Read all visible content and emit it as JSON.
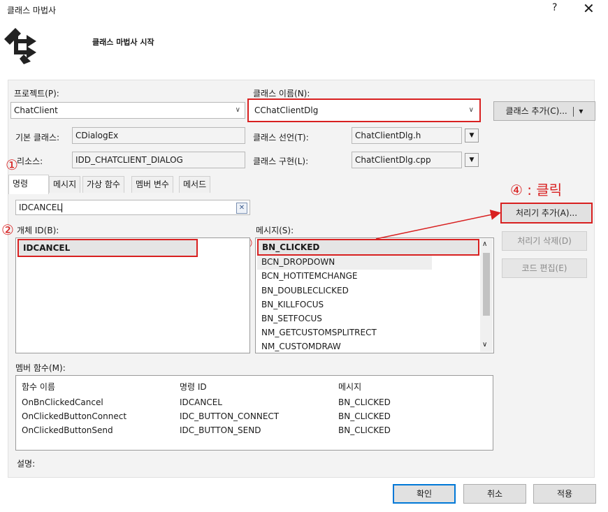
{
  "window": {
    "title": "클래스 마법사",
    "help_label": "?",
    "close_label": "✕"
  },
  "header": {
    "title": "클래스 마법사 시작",
    "logo_icon": "class-wizard-logo-icon"
  },
  "project": {
    "label": "프로젝트(P):",
    "value": "ChatClient"
  },
  "class_name": {
    "label": "클래스 이름(N):",
    "value": "CChatClientDlg"
  },
  "add_class": {
    "label": "클래스 추가(C)...",
    "arrow": "▾"
  },
  "base_class": {
    "label": "기본 클래스:",
    "value": "CDialogEx"
  },
  "resource": {
    "label": "리소스:",
    "value": "IDD_CHATCLIENT_DIALOG"
  },
  "class_decl": {
    "label": "클래스 선언(T):",
    "value": "ChatClientDlg.h"
  },
  "class_impl": {
    "label": "클래스 구현(L):",
    "value": "ChatClientDlg.cpp"
  },
  "tabs": [
    {
      "label": "명령"
    },
    {
      "label": "메시지"
    },
    {
      "label": "가상 함수"
    },
    {
      "label": "멤버 변수"
    },
    {
      "label": "메서드"
    }
  ],
  "search": {
    "value": "IDCANCEL",
    "clear_label": "✕"
  },
  "object_ids": {
    "label": "개체 ID(B):",
    "items": [
      "IDCANCEL"
    ]
  },
  "messages": {
    "label": "메시지(S):",
    "items": [
      "BN_CLICKED",
      "BCN_DROPDOWN",
      "BCN_HOTITEMCHANGE",
      "BN_DOUBLECLICKED",
      "BN_KILLFOCUS",
      "BN_SETFOCUS",
      "NM_GETCUSTOMSPLITRECT",
      "NM_CUSTOMDRAW"
    ]
  },
  "buttons": {
    "add_handler": "처리기 추가(A)...",
    "delete_handler": "처리기 삭제(D)",
    "edit_code": "코드 편집(E)"
  },
  "member_functions": {
    "label": "멤버 함수(M):",
    "columns": [
      "함수 이름",
      "명령 ID",
      "메시지"
    ],
    "rows": [
      [
        "OnBnClickedCancel",
        "IDCANCEL",
        "BN_CLICKED"
      ],
      [
        "OnClickedButtonConnect",
        "IDC_BUTTON_CONNECT",
        "BN_CLICKED"
      ],
      [
        "OnClickedButtonSend",
        "IDC_BUTTON_SEND",
        "BN_CLICKED"
      ]
    ]
  },
  "description": {
    "label": "설명:"
  },
  "footer": {
    "ok": "확인",
    "cancel": "취소",
    "apply": "적용"
  },
  "annotations": {
    "step1": "①",
    "step2": "②",
    "step3": "③",
    "step4": "④ : 클릭"
  },
  "colors": {
    "annotation": "#d82020",
    "selection": "#e5e5e5"
  }
}
